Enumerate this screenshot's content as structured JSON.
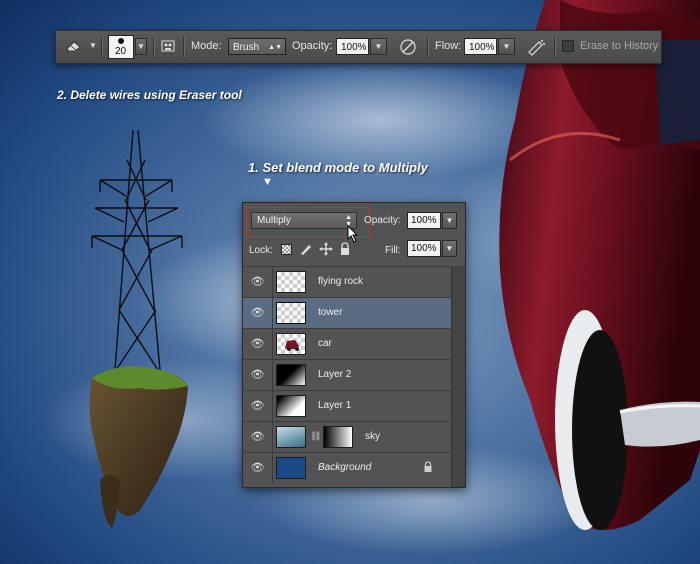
{
  "toolbar": {
    "brush_size": "20",
    "mode_label": "Mode:",
    "mode_value": "Brush",
    "opacity_label": "Opacity:",
    "opacity_value": "100%",
    "flow_label": "Flow:",
    "flow_value": "100%",
    "erase_history_label": "Erase to History",
    "erase_history_checked": false
  },
  "annotations": {
    "step2": "2. Delete wires using Eraser tool",
    "step1": "1. Set blend mode to Multiply"
  },
  "layers_panel": {
    "blend_mode": "Multiply",
    "opacity_label": "Opacity:",
    "opacity_value": "100%",
    "lock_label": "Lock:",
    "fill_label": "Fill:",
    "fill_value": "100%",
    "selected_layer": "tower",
    "layers": [
      {
        "name": "flying rock",
        "thumb": "transparent"
      },
      {
        "name": "tower",
        "thumb": "transparent"
      },
      {
        "name": "car",
        "thumb": "car"
      },
      {
        "name": "Layer 2",
        "thumb": "gradient-dark"
      },
      {
        "name": "Layer 1",
        "thumb": "gradient-light"
      },
      {
        "name": "sky",
        "thumb": "sky",
        "has_mask": true
      },
      {
        "name": "Background",
        "thumb": "blue",
        "locked": true,
        "color": "#1b4a86"
      }
    ]
  },
  "colors": {
    "highlight": "#d8282a",
    "selected_row": "#5a6b82",
    "sky_top": "#0d2a5a"
  }
}
